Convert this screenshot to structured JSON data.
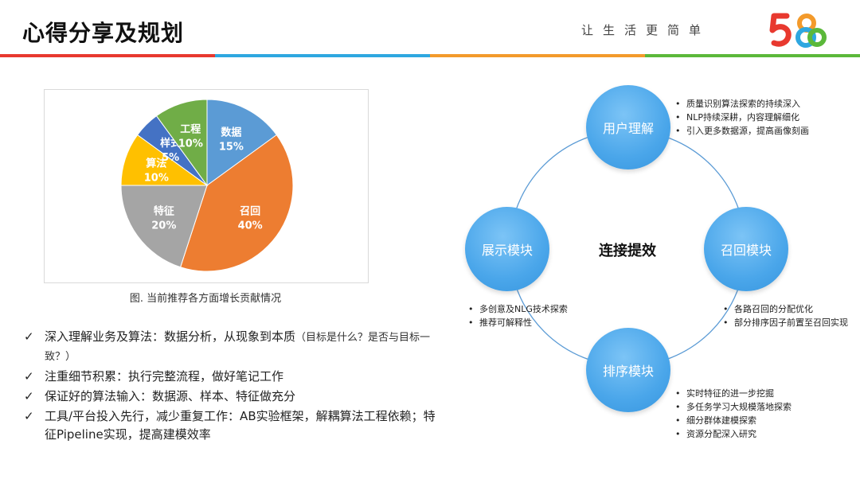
{
  "header": {
    "title": "心得分享及规划",
    "slogan": "让生活更简单",
    "logo_text": "58",
    "stripe_colors": [
      "#e8392f",
      "#2ea7e0",
      "#f39a2b",
      "#5bb83a"
    ]
  },
  "chart_data": {
    "type": "pie",
    "slices": [
      {
        "label": "数据",
        "value": 15,
        "value_label": "15%",
        "color": "#5b9bd5"
      },
      {
        "label": "召回",
        "value": 40,
        "value_label": "40%",
        "color": "#ed7d31"
      },
      {
        "label": "特征",
        "value": 20,
        "value_label": "20%",
        "color": "#a5a5a5"
      },
      {
        "label": "算法",
        "value": 10,
        "value_label": "10%",
        "color": "#ffc000"
      },
      {
        "label": "样式",
        "value": 5,
        "value_label": "5%",
        "color": "#4472c4"
      },
      {
        "label": "工程",
        "value": 10,
        "value_label": "10%",
        "color": "#70ad47"
      }
    ],
    "caption": "图. 当前推荐各方面增长贡献情况"
  },
  "bullets": [
    {
      "check": "✓",
      "main": "深入理解业务及算法：数据分析，从现象到本质",
      "extra": "（目标是什么？是否与目标一致？）"
    },
    {
      "check": "✓",
      "main": "注重细节积累：执行完整流程，做好笔记工作",
      "extra": ""
    },
    {
      "check": "✓",
      "main": "保证好的算法输入：数据源、样本、特征做充分",
      "extra": ""
    },
    {
      "check": "✓",
      "main": "工具/平台投入先行，减少重复工作：AB实验框架，解耦算法工程依赖；特征Pipeline实现，提高建模效率",
      "extra": ""
    }
  ],
  "cycle": {
    "center": "连接提效",
    "nodes": {
      "top": "用户理解",
      "right": "召回模块",
      "bottom": "排序模块",
      "left": "展示模块"
    },
    "notes": {
      "top": [
        "质量识别算法探索的持续深入",
        "NLP持续深耕，内容理解细化",
        "引入更多数据源，提高画像刻画"
      ],
      "right": [
        "各路召回的分配优化",
        "部分排序因子前置至召回实现"
      ],
      "bottom": [
        "实时特征的进一步挖掘",
        "多任务学习大规模落地探索",
        "细分群体建模探索",
        "资源分配深入研究"
      ],
      "left": [
        "多创意及NLG技术探索",
        "推荐可解释性"
      ]
    }
  }
}
